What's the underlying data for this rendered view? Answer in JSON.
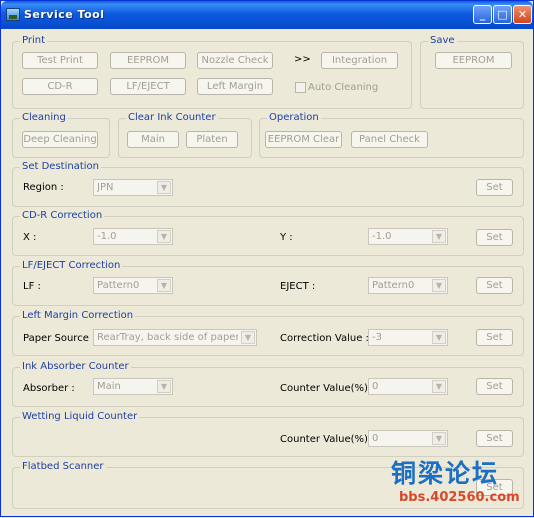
{
  "window": {
    "title": "Service Tool"
  },
  "print": {
    "legend": "Print",
    "test_print": "Test Print",
    "eeprom": "EEPROM",
    "nozzle_check": "Nozzle Check",
    "arrows": ">>",
    "integration": "Integration",
    "cd_r": "CD-R",
    "lf_eject": "LF/EJECT",
    "left_margin": "Left Margin",
    "auto_cleaning": "Auto Cleaning"
  },
  "save": {
    "legend": "Save",
    "eeprom": "EEPROM"
  },
  "cleaning": {
    "legend": "Cleaning",
    "deep_cleaning": "Deep Cleaning"
  },
  "clear_ink": {
    "legend": "Clear Ink Counter",
    "main": "Main",
    "platen": "Platen"
  },
  "operation": {
    "legend": "Operation",
    "eeprom_clear": "EEPROM Clear",
    "panel_check": "Panel Check"
  },
  "set_destination": {
    "legend": "Set Destination",
    "region_label": "Region :",
    "region_value": "JPN",
    "set": "Set"
  },
  "cdr_correction": {
    "legend": "CD-R Correction",
    "x_label": "X :",
    "x_value": "-1.0",
    "y_label": "Y :",
    "y_value": "-1.0",
    "set": "Set"
  },
  "lfeject_correction": {
    "legend": "LF/EJECT Correction",
    "lf_label": "LF :",
    "lf_value": "Pattern0",
    "eject_label": "EJECT :",
    "eject_value": "Pattern0",
    "set": "Set"
  },
  "left_margin_correction": {
    "legend": "Left Margin Correction",
    "paper_label": "Paper Source :",
    "paper_value": "RearTray, back side of paper",
    "corr_label": "Correction Value :",
    "corr_value": "-3",
    "set": "Set"
  },
  "ink_absorber": {
    "legend": "Ink Absorber Counter",
    "absorber_label": "Absorber :",
    "absorber_value": "Main",
    "counter_label": "Counter Value(%) :",
    "counter_value": "0",
    "set": "Set"
  },
  "wetting": {
    "legend": "Wetting Liquid Counter",
    "counter_label": "Counter Value(%) :",
    "counter_value": "0",
    "set": "Set"
  },
  "flatbed": {
    "legend": "Flatbed Scanner",
    "set": "Set"
  },
  "watermark": {
    "text": "铜梁论坛",
    "url": "bbs.402560.com"
  }
}
